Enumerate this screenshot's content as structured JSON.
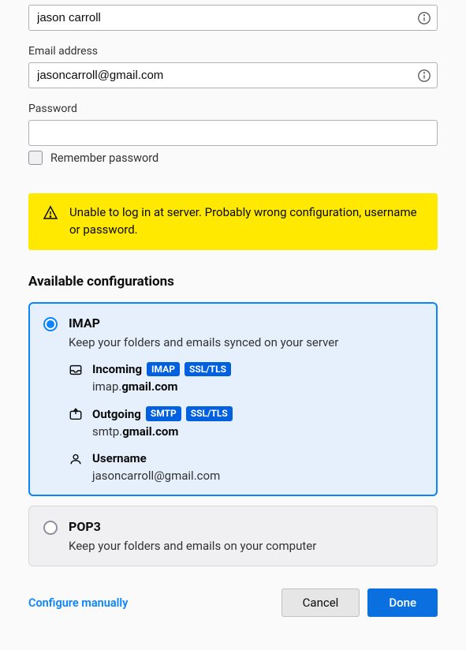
{
  "fields": {
    "name_value": "jason carroll",
    "email_label": "Email address",
    "email_value": "jasoncarroll@gmail.com",
    "password_label": "Password",
    "password_value": "",
    "remember_password_label": "Remember password"
  },
  "alert": {
    "message": "Unable to log in at server. Probably wrong configuration, username or password."
  },
  "heading": "Available configurations",
  "configs": {
    "imap": {
      "title": "IMAP",
      "desc": "Keep your folders and emails synced on your server",
      "incoming_label": "Incoming",
      "incoming_tags": [
        "IMAP",
        "SSL/TLS"
      ],
      "incoming_prefix": "imap.",
      "incoming_host": "gmail.com",
      "outgoing_label": "Outgoing",
      "outgoing_tags": [
        "SMTP",
        "SSL/TLS"
      ],
      "outgoing_prefix": "smtp.",
      "outgoing_host": "gmail.com",
      "username_label": "Username",
      "username_value": "jasoncarroll@gmail.com"
    },
    "pop3": {
      "title": "POP3",
      "desc": "Keep your folders and emails on your computer"
    }
  },
  "footer": {
    "configure_manually": "Configure manually",
    "cancel": "Cancel",
    "done": "Done"
  }
}
